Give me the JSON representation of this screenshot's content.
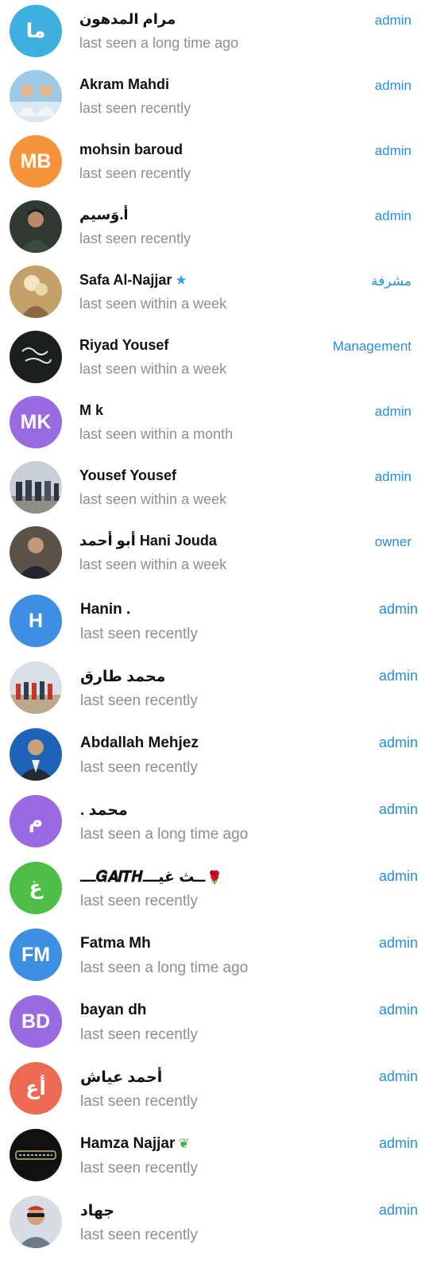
{
  "members": [
    {
      "name": "مرام المدهون",
      "status": "last seen a long time ago",
      "role": "admin",
      "avatar": {
        "type": "initials",
        "initials": "ما",
        "color": "#3fb0de"
      }
    },
    {
      "name": "Akram Mahdi",
      "status": "last seen recently",
      "role": "admin",
      "avatar": {
        "type": "photo"
      }
    },
    {
      "name": "mohsin baroud",
      "status": "last seen recently",
      "role": "admin",
      "avatar": {
        "type": "initials",
        "initials": "MB",
        "color": "#f5943a"
      }
    },
    {
      "name": "أ.وَسيم",
      "status": "last seen recently",
      "role": "admin",
      "avatar": {
        "type": "photo"
      }
    },
    {
      "name": "Safa Al-Najjar",
      "status": "last seen within a week",
      "role": "مشرفة",
      "avatar": {
        "type": "photo"
      },
      "badge": "star-icon"
    },
    {
      "name": "Riyad Yousef",
      "status": "last seen within a week",
      "role": "Management",
      "avatar": {
        "type": "photo"
      }
    },
    {
      "name": "M k",
      "status": "last seen within a month",
      "role": "admin",
      "avatar": {
        "type": "initials",
        "initials": "MK",
        "color": "#9a6ae0"
      }
    },
    {
      "name": "Yousef Yousef",
      "status": "last seen within a week",
      "role": "admin",
      "avatar": {
        "type": "photo"
      }
    },
    {
      "name": "أبو أحمد Hani Jouda",
      "status": "last seen within a week",
      "role": "owner",
      "avatar": {
        "type": "photo"
      }
    },
    {
      "name": "Hanin .",
      "status": "last seen recently",
      "role": "admin",
      "avatar": {
        "type": "initials",
        "initials": "H",
        "color": "#3d8fe3"
      }
    },
    {
      "name": "محمد طارق",
      "status": "last seen recently",
      "role": "admin",
      "avatar": {
        "type": "photo"
      }
    },
    {
      "name": "Abdallah Mehjez",
      "status": "last seen recently",
      "role": "admin",
      "avatar": {
        "type": "photo"
      }
    },
    {
      "name": ". محمد",
      "status": "last seen a long time ago",
      "role": "admin",
      "avatar": {
        "type": "initials",
        "initials": "م",
        "color": "#9a6ae0"
      }
    },
    {
      "name": "ـــ𝑮𝑨𝑰𝑻𝑯ــث غيـــ",
      "status": "last seen recently",
      "role": "admin",
      "avatar": {
        "type": "initials",
        "initials": "غ",
        "color": "#4fbe48"
      },
      "badge": "rose-icon"
    },
    {
      "name": "Fatma Mh",
      "status": "last seen a long time ago",
      "role": "admin",
      "avatar": {
        "type": "initials",
        "initials": "FM",
        "color": "#3d8fe3"
      }
    },
    {
      "name": "bayan dh",
      "status": "last seen recently",
      "role": "admin",
      "avatar": {
        "type": "initials",
        "initials": "BD",
        "color": "#9a6ae0"
      }
    },
    {
      "name": "أحمد عياش",
      "status": "last seen recently",
      "role": "admin",
      "avatar": {
        "type": "initials",
        "initials": "أع",
        "color": "#ec6a52"
      }
    },
    {
      "name": "Hamza Najjar",
      "status": "last seen recently",
      "role": "admin",
      "avatar": {
        "type": "photo"
      },
      "badge": "leaf-icon"
    },
    {
      "name": "جهاد",
      "status": "last seen recently",
      "role": "admin",
      "avatar": {
        "type": "photo"
      }
    }
  ]
}
